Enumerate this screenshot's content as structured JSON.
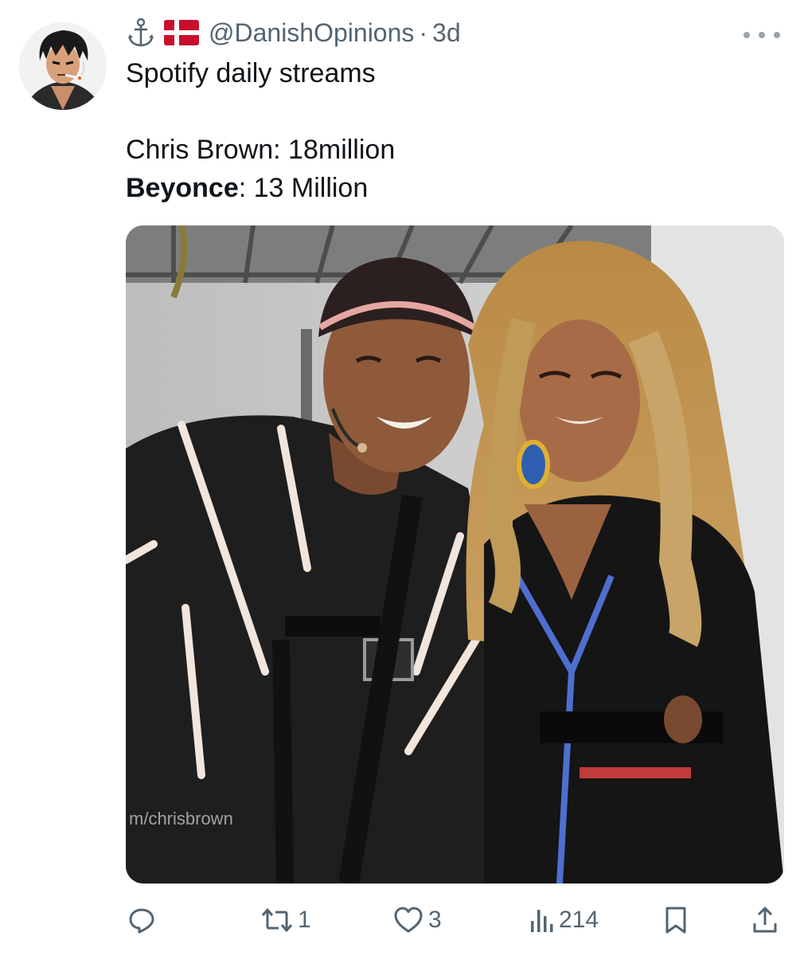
{
  "tweet": {
    "emojis": [
      "anchor-icon",
      "denmark-flag-icon"
    ],
    "handle": "@DanishOpinions",
    "separator": "·",
    "time": "3d",
    "line1": "Spotify daily streams",
    "line2": "Chris Brown: 18million",
    "line3_bold": "Beyonce",
    "line3_rest": ": 13 Million",
    "watermark": "m/chrisbrown"
  },
  "actions": {
    "reply_count": "",
    "retweet_count": "1",
    "like_count": "3",
    "views_count": "214"
  },
  "colors": {
    "text": "#0f1419",
    "secondary": "#536471",
    "flag_red": "#c8102e"
  }
}
